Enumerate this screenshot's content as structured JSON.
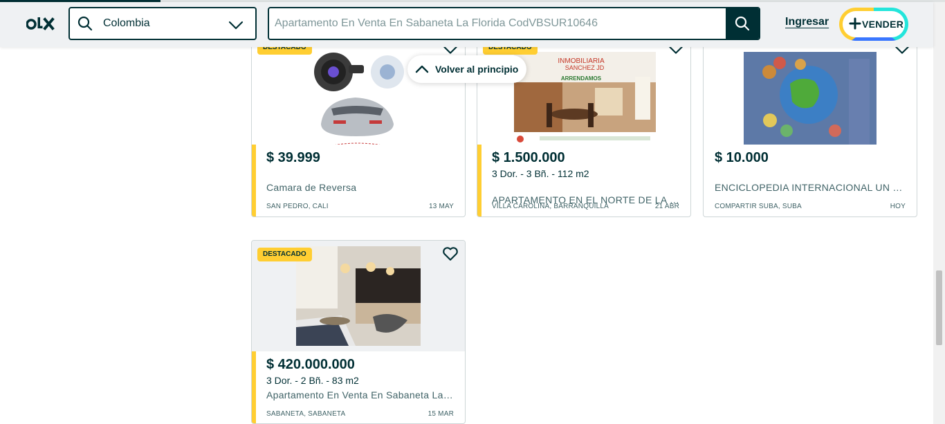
{
  "brand": {
    "logo_text": "olx",
    "accent": "#002f34",
    "featured_color": "#ffce32"
  },
  "header": {
    "location": {
      "value": "Colombia"
    },
    "search": {
      "placeholder": "Apartamento En Venta En Sabaneta La Florida CodVBSUR10646"
    },
    "login_label": "Ingresar",
    "sell_label": "VENDER"
  },
  "back_to_top_label": "Volver al principio",
  "badge_label": "DESTACADO",
  "listings": [
    {
      "price": "$ 39.999",
      "specs": "",
      "title": "Camara de Reversa",
      "location": "SAN PEDRO, CALI",
      "date": "13 MAY",
      "featured": true
    },
    {
      "price": "$ 1.500.000",
      "specs": "3 Dor. - 3 Bñ. - 112 m2",
      "title": "APARTAMENTO EN EL NORTE DE LA CIUDAD",
      "location": "VILLA CAROLINA, BARRANQUILLA",
      "date": "21 ABR",
      "featured": true,
      "image_text": {
        "line1": "INMOBILIARIA",
        "line2": "SANCHEZ JD",
        "line3": "ARRENDAMOS"
      }
    },
    {
      "price": "$ 10.000",
      "specs": "",
      "title": "ENCICLOPEDIA INTERNACIONAL UN MUNDO",
      "location": "COMPARTIR SUBA, SUBA",
      "date": "HOY",
      "featured": false
    },
    {
      "price": "$ 420.000.000",
      "specs": "3 Dor. - 2 Bñ. - 83 m2",
      "title": "Apartamento En Venta En Sabaneta La Florida",
      "location": "SABANETA, SABANETA",
      "date": "15 MAR",
      "featured": true
    }
  ]
}
